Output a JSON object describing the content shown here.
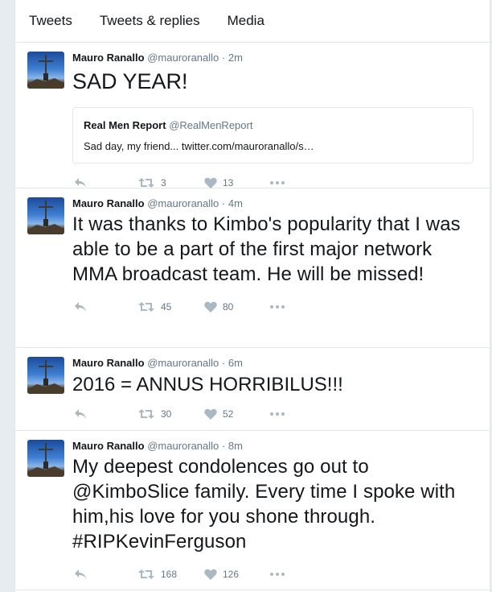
{
  "tabs": [
    "Tweets",
    "Tweets & replies",
    "Media"
  ],
  "colors": {
    "icon": "#aab8c2",
    "muted": "#657786",
    "text": "#14171a",
    "border": "#e1e8ed"
  },
  "tweets": [
    {
      "name": "Mauro Ranallo",
      "handle": "@mauroranallo",
      "separator": "·",
      "time": "2m",
      "text": "SAD YEAR!",
      "quote": {
        "name": "Real Men Report",
        "handle": "@RealMenReport",
        "text": "Sad day, my friend... twitter.com/mauroranallo/s…"
      },
      "retweets": "3",
      "likes": "13"
    },
    {
      "name": "Mauro Ranallo",
      "handle": "@mauroranallo",
      "separator": "·",
      "time": "4m",
      "text": "It was thanks to Kimbo's popularity that I was able to be a part of the first major network MMA broadcast team. He will be missed!",
      "retweets": "45",
      "likes": "80"
    },
    {
      "name": "Mauro Ranallo",
      "handle": "@mauroranallo",
      "separator": "·",
      "time": "6m",
      "text": "2016 = ANNUS HORRIBILUS!!!",
      "retweets": "30",
      "likes": "52"
    },
    {
      "name": "Mauro Ranallo",
      "handle": "@mauroranallo",
      "separator": "·",
      "time": "8m",
      "text": "My deepest condolences go out to @KimboSlice family. Every time I spoke with him,his love for you shone through. #RIPKevinFerguson",
      "retweets": "168",
      "likes": "126"
    }
  ]
}
